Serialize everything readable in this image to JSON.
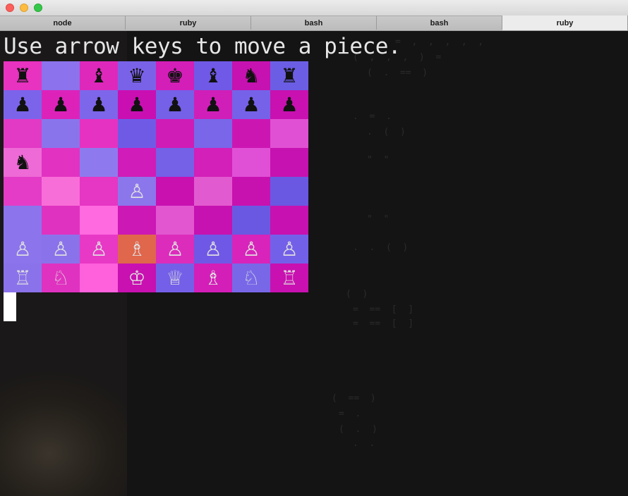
{
  "window": {
    "tabs": [
      {
        "label": "node",
        "active": false
      },
      {
        "label": "ruby",
        "active": false
      },
      {
        "label": "bash",
        "active": false
      },
      {
        "label": "bash",
        "active": false
      },
      {
        "label": "ruby",
        "active": true
      }
    ]
  },
  "terminal": {
    "prompt_text": "Use arrow keys to move a piece.",
    "board": {
      "rows": [
        [
          "♜",
          "",
          "♝",
          "♛",
          "♚",
          "♝",
          "♞",
          "♜"
        ],
        [
          "♟",
          "♟",
          "♟",
          "♟",
          "♟",
          "♟",
          "♟",
          "♟"
        ],
        [
          "",
          "",
          "",
          "",
          "",
          "",
          "",
          ""
        ],
        [
          "♞",
          "",
          "",
          "",
          "",
          "",
          "",
          ""
        ],
        [
          "",
          "",
          "",
          "♙",
          "",
          "",
          "",
          ""
        ],
        [
          "",
          "",
          "",
          "",
          "",
          "",
          "",
          ""
        ],
        [
          "♙",
          "♙",
          "♙",
          "♗",
          "♙",
          "♙",
          "♙",
          "♙"
        ],
        [
          "♖",
          "♘",
          "",
          "♔",
          "♕",
          "♗",
          "♘",
          "♖"
        ]
      ],
      "sides": [
        [
          "b",
          "",
          "b",
          "b",
          "b",
          "b",
          "b",
          "b"
        ],
        [
          "b",
          "b",
          "b",
          "b",
          "b",
          "b",
          "b",
          "b"
        ],
        [
          "",
          "",
          "",
          "",
          "",
          "",
          "",
          ""
        ],
        [
          "b",
          "",
          "",
          "",
          "",
          "",
          "",
          ""
        ],
        [
          "",
          "",
          "",
          "w",
          "",
          "",
          "",
          ""
        ],
        [
          "",
          "",
          "",
          "",
          "",
          "",
          "",
          ""
        ],
        [
          "w",
          "w",
          "w",
          "w",
          "w",
          "w",
          "w",
          "w"
        ],
        [
          "w",
          "w",
          "",
          "w",
          "w",
          "w",
          "w",
          "w"
        ]
      ],
      "colors": [
        [
          "#e832c0",
          "#8c72ec",
          "#de28bc",
          "#7a62e8",
          "#d41eb8",
          "#7059e6",
          "#c612b0",
          "#6b5ee4"
        ],
        [
          "#7c64ea",
          "#dd22ba",
          "#7d66ea",
          "#c90fb2",
          "#7560e8",
          "#d01fb8",
          "#7662e9",
          "#c811b0"
        ],
        [
          "#e23ac4",
          "#8a74ec",
          "#e632c2",
          "#6f5ae6",
          "#cf1cb6",
          "#7a66e8",
          "#cc16b2",
          "#e050d4"
        ],
        [
          "#ee6ad6",
          "#e232c2",
          "#8e7aee",
          "#d01cb8",
          "#7560e8",
          "#d220b8",
          "#e050d6",
          "#c612b0"
        ],
        [
          "#e43cc6",
          "#f86ed8",
          "#e636c4",
          "#8c76ec",
          "#c911b0",
          "#e25ad0",
          "#c812b0",
          "#6a58e2"
        ],
        [
          "#8c74ec",
          "#e032c0",
          "#ff6ae0",
          "#cc18b4",
          "#e256d0",
          "#c612b0",
          "#6a58e2",
          "#c711b0"
        ],
        [
          "#8c74ec",
          "#8a72ea",
          "#e838c6",
          "#e0664c",
          "#dc2cbc",
          "#7058e6",
          "#d824ba",
          "#7360e8"
        ],
        [
          "#8a72ea",
          "#e032c0",
          "#ff60dc",
          "#c811b0",
          "#7460e8",
          "#d41eb8",
          "#7868e8",
          "#c811b0"
        ]
      ],
      "highlighted_square": "d2"
    }
  }
}
